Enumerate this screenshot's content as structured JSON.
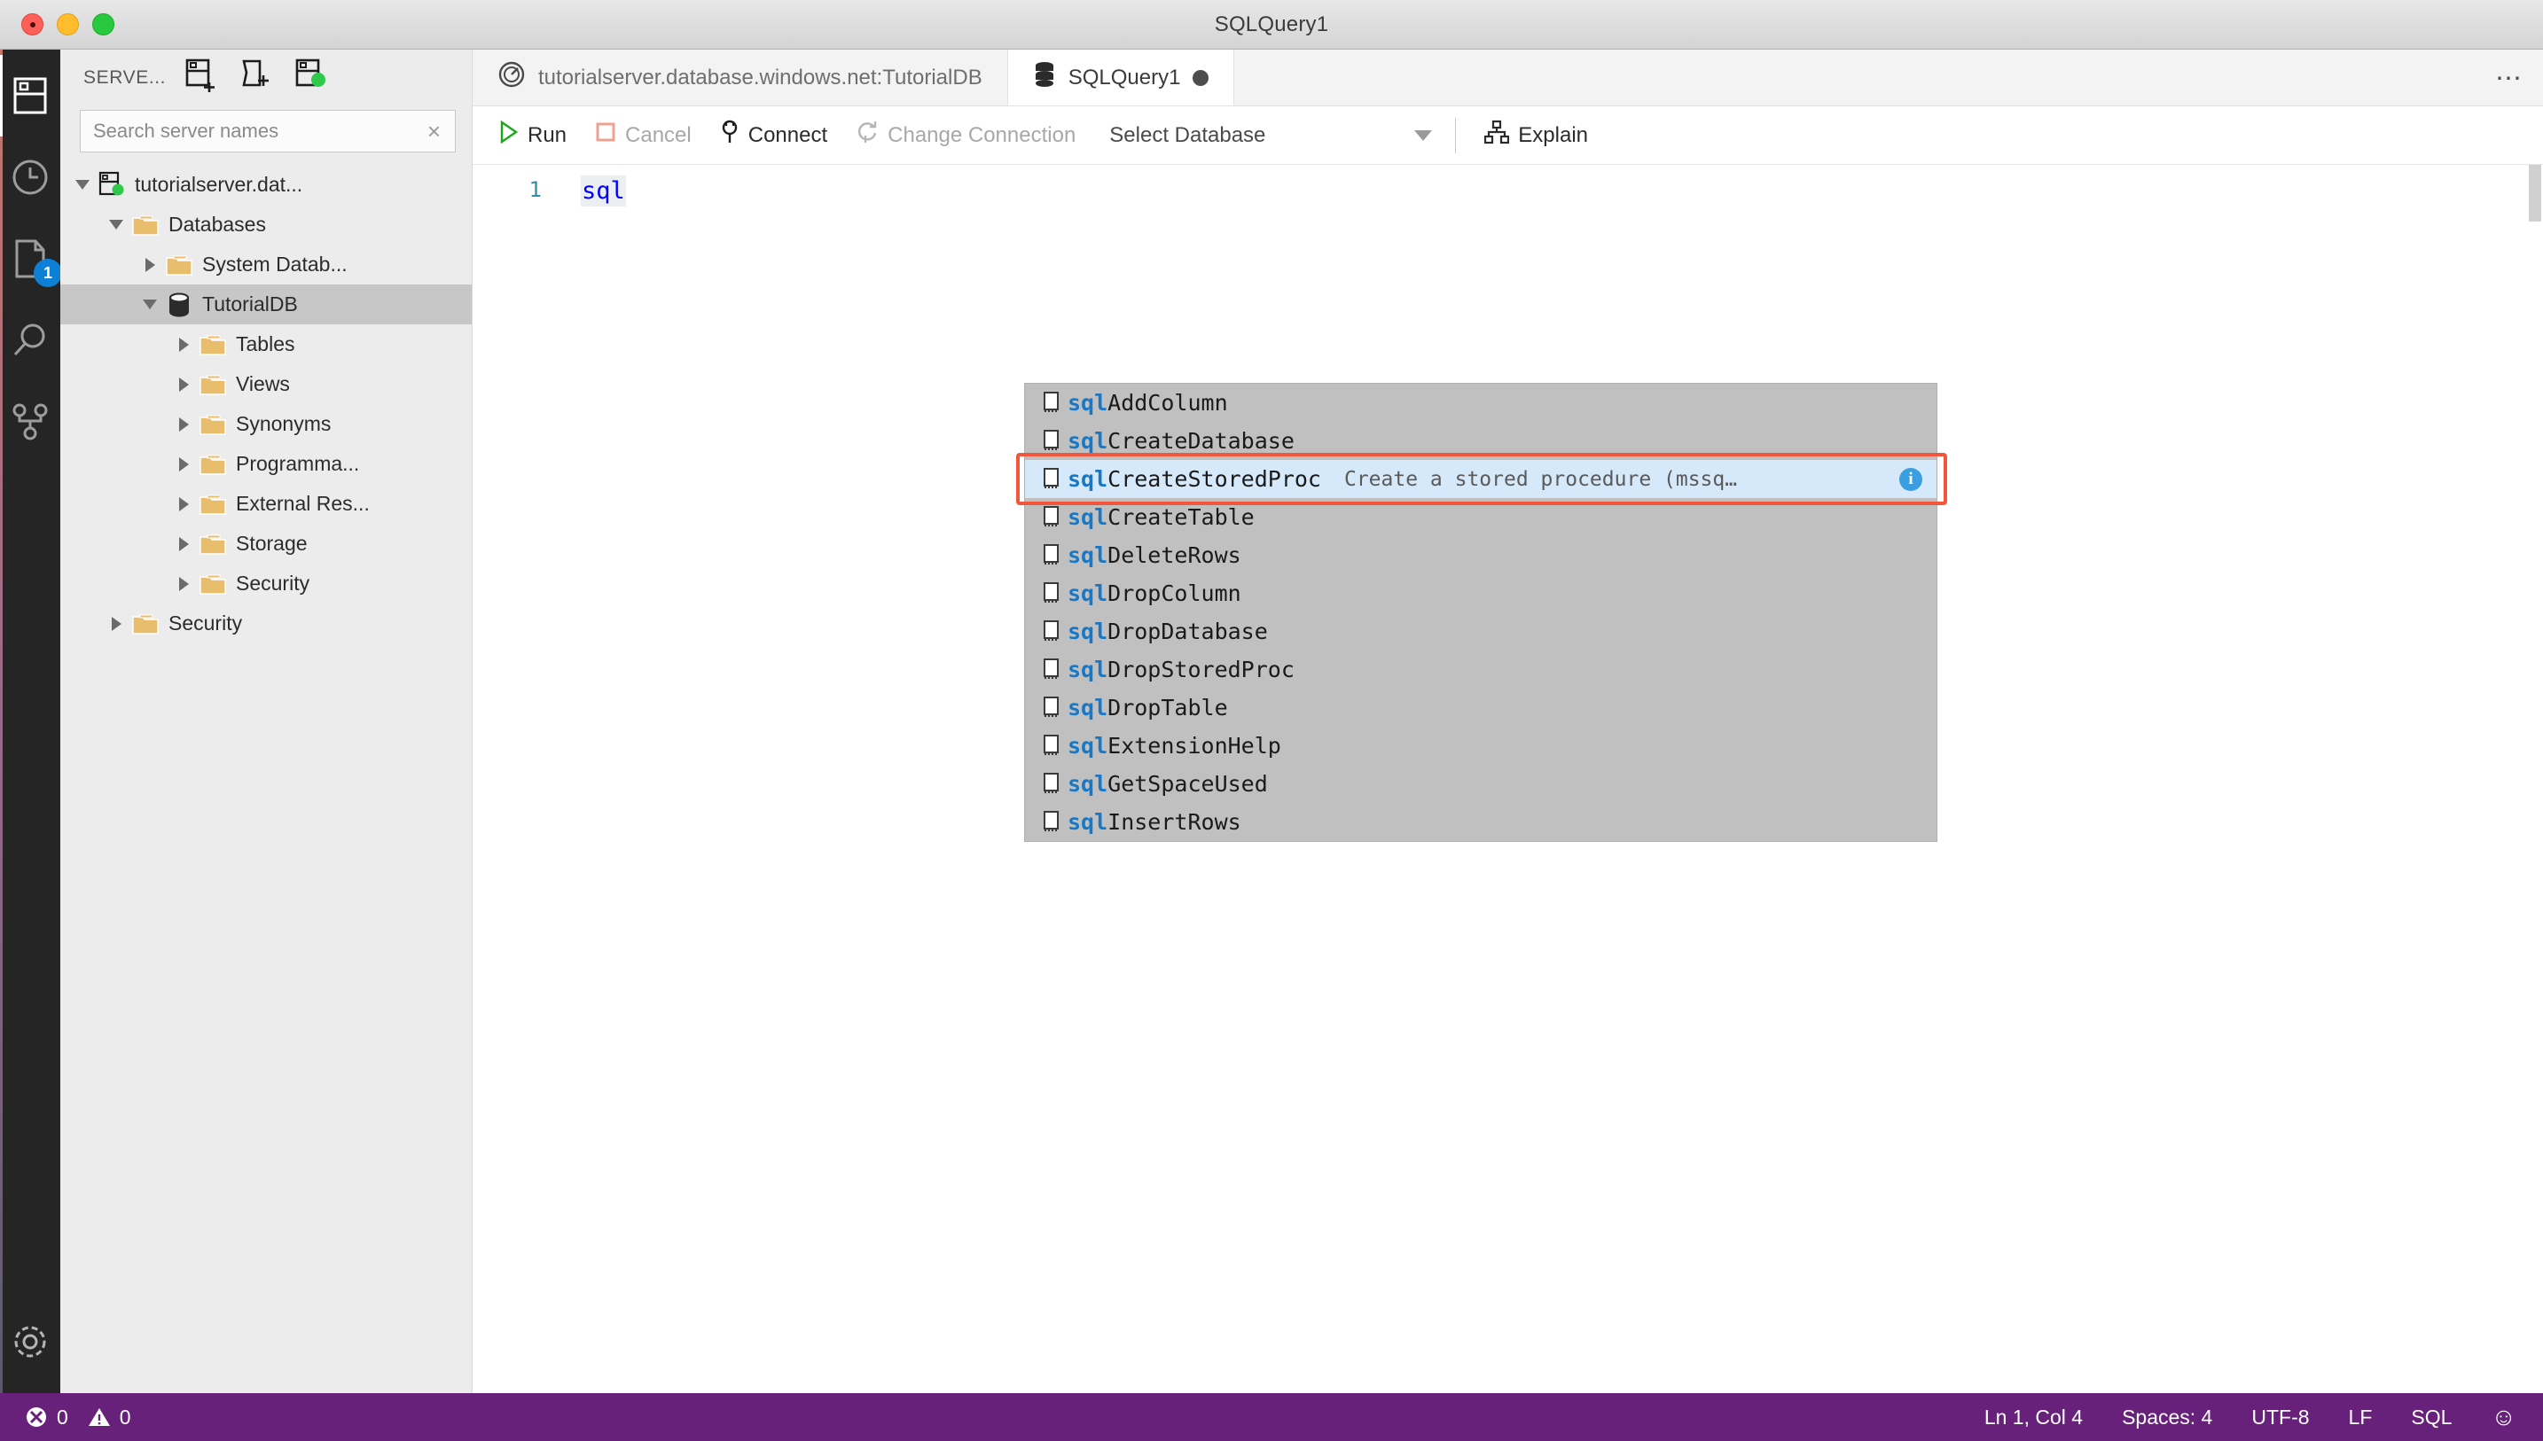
{
  "window": {
    "title": "SQLQuery1"
  },
  "activitybar": {
    "items": [
      {
        "name": "servers-icon",
        "label": "Servers",
        "active": true,
        "badge": null
      },
      {
        "name": "history-icon",
        "label": "Query History",
        "active": false,
        "badge": null
      },
      {
        "name": "notebook-icon",
        "label": "Notebooks",
        "active": false,
        "badge": "1"
      },
      {
        "name": "search-icon",
        "label": "Search",
        "active": false,
        "badge": null
      },
      {
        "name": "source-control-icon",
        "label": "Source Control",
        "active": false,
        "badge": null
      }
    ],
    "settings": {
      "name": "gear-icon",
      "label": "Manage"
    }
  },
  "sidebar": {
    "title": "SERVE...",
    "actions": [
      {
        "name": "new-connection-icon",
        "label": "New Connection"
      },
      {
        "name": "new-server-group-icon",
        "label": "New Server Group"
      },
      {
        "name": "active-connections-icon",
        "label": "Show Active Connections"
      }
    ],
    "search": {
      "placeholder": "Search server names",
      "value": "",
      "clear": "×"
    },
    "tree": [
      {
        "label": "tutorialserver.dat...",
        "icon": "server-connected-icon",
        "depth": 0,
        "twisty": "down",
        "selected": false
      },
      {
        "label": "Databases",
        "icon": "folder-icon",
        "depth": 1,
        "twisty": "down",
        "selected": false
      },
      {
        "label": "System Datab...",
        "icon": "folder-icon",
        "depth": 2,
        "twisty": "right",
        "selected": false
      },
      {
        "label": "TutorialDB",
        "icon": "database-icon",
        "depth": 2,
        "twisty": "down",
        "selected": true
      },
      {
        "label": "Tables",
        "icon": "folder-icon",
        "depth": 3,
        "twisty": "right",
        "selected": false
      },
      {
        "label": "Views",
        "icon": "folder-icon",
        "depth": 3,
        "twisty": "right",
        "selected": false
      },
      {
        "label": "Synonyms",
        "icon": "folder-icon",
        "depth": 3,
        "twisty": "right",
        "selected": false
      },
      {
        "label": "Programma...",
        "icon": "folder-icon",
        "depth": 3,
        "twisty": "right",
        "selected": false
      },
      {
        "label": "External Res...",
        "icon": "folder-icon",
        "depth": 3,
        "twisty": "right",
        "selected": false
      },
      {
        "label": "Storage",
        "icon": "folder-icon",
        "depth": 3,
        "twisty": "right",
        "selected": false
      },
      {
        "label": "Security",
        "icon": "folder-icon",
        "depth": 3,
        "twisty": "right",
        "selected": false
      },
      {
        "label": "Security",
        "icon": "folder-icon",
        "depth": 1,
        "twisty": "right",
        "selected": false
      }
    ]
  },
  "tabs": {
    "items": [
      {
        "label": "tutorialserver.database.windows.net:TutorialDB",
        "icon": "dashboard-icon",
        "active": false,
        "dirty": false
      },
      {
        "label": "SQLQuery1",
        "icon": "database-icon",
        "active": true,
        "dirty": true
      }
    ],
    "more": "⋯"
  },
  "toolbar": {
    "run": "Run",
    "cancel": "Cancel",
    "connect": "Connect",
    "change_connection": "Change Connection",
    "select_database": "Select Database",
    "explain": "Explain"
  },
  "editor": {
    "line_numbers": [
      "1"
    ],
    "code": "sql",
    "cursor_col": 4
  },
  "autocomplete": {
    "prefix": "sql",
    "selected_index": 2,
    "items": [
      {
        "prefix": "sql",
        "rest": "AddColumn",
        "desc": ""
      },
      {
        "prefix": "sql",
        "rest": "CreateDatabase",
        "desc": ""
      },
      {
        "prefix": "sql",
        "rest": "CreateStoredProc",
        "desc": "Create a stored procedure (mssq…",
        "info": "i"
      },
      {
        "prefix": "sql",
        "rest": "CreateTable",
        "desc": ""
      },
      {
        "prefix": "sql",
        "rest": "DeleteRows",
        "desc": ""
      },
      {
        "prefix": "sql",
        "rest": "DropColumn",
        "desc": ""
      },
      {
        "prefix": "sql",
        "rest": "DropDatabase",
        "desc": ""
      },
      {
        "prefix": "sql",
        "rest": "DropStoredProc",
        "desc": ""
      },
      {
        "prefix": "sql",
        "rest": "DropTable",
        "desc": ""
      },
      {
        "prefix": "sql",
        "rest": "ExtensionHelp",
        "desc": ""
      },
      {
        "prefix": "sql",
        "rest": "GetSpaceUsed",
        "desc": ""
      },
      {
        "prefix": "sql",
        "rest": "InsertRows",
        "desc": ""
      }
    ]
  },
  "statusbar": {
    "errors": "0",
    "warnings": "0",
    "position": "Ln 1, Col 4",
    "indentation": "Spaces: 4",
    "encoding": "UTF-8",
    "eol": "LF",
    "language": "SQL",
    "feedback": "☺"
  },
  "colors": {
    "status_bar": "#68217a",
    "accent_blue": "#1778c8",
    "highlight_red": "#f2563c",
    "selection_blue": "#d6e9fb",
    "folder": "#e8be6c",
    "green_dot": "#2ec94a"
  }
}
